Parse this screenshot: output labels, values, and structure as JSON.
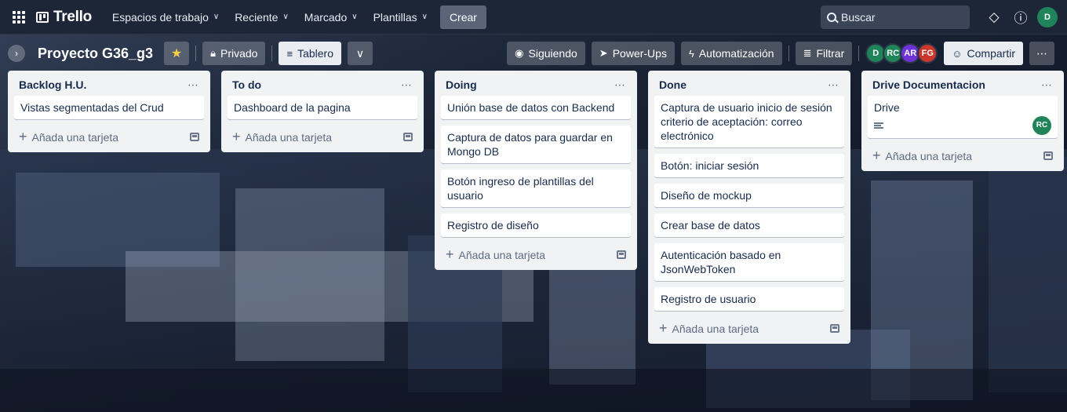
{
  "topnav": {
    "logo": "Trello",
    "menus": [
      {
        "label": "Espacios de trabajo"
      },
      {
        "label": "Reciente"
      },
      {
        "label": "Marcado"
      },
      {
        "label": "Plantillas"
      }
    ],
    "create_label": "Crear",
    "search_placeholder": "Buscar",
    "user_initial": "D",
    "user_color": "#1f845a"
  },
  "board": {
    "title": "Proyecto G36_g3",
    "visibility_label": "Privado",
    "view_label": "Tablero",
    "following_label": "Siguiendo",
    "powerups_label": "Power-Ups",
    "automation_label": "Automatización",
    "filter_label": "Filtrar",
    "share_label": "Compartir",
    "members": [
      {
        "initials": "D",
        "color": "#1f845a"
      },
      {
        "initials": "RC",
        "color": "#1f845a"
      },
      {
        "initials": "AR",
        "color": "#6e32d8"
      },
      {
        "initials": "FG",
        "color": "#c9372c"
      }
    ]
  },
  "add_card_label": "Añada una tarjeta",
  "lists": [
    {
      "title": "Backlog H.U.",
      "cards": [
        "Vistas segmentadas del Crud"
      ]
    },
    {
      "title": "To do",
      "cards": [
        "Dashboard de la pagina"
      ]
    },
    {
      "title": "Doing",
      "cards": [
        "Unión base de datos con Backend",
        "Captura de datos para guardar en Mongo DB",
        "Botón ingreso de plantillas del usuario",
        "Registro de diseño"
      ]
    },
    {
      "title": "Done",
      "cards": [
        "Captura de usuario inicio de sesión criterio de aceptación: correo electrónico",
        "Botón: iniciar sesión",
        "Diseño de mockup",
        "Crear base de datos",
        "Autenticación basado en JsonWebToken",
        "Registro de usuario"
      ]
    },
    {
      "title": "Drive Documentacion",
      "cards": [
        "Drive"
      ],
      "card_member": {
        "initials": "RC",
        "color": "#1f845a"
      }
    }
  ]
}
